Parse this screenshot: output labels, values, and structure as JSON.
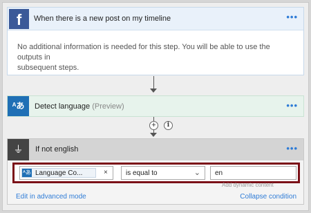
{
  "trigger": {
    "icon": "facebook-icon",
    "icon_glyph": "f",
    "title": "When there is a new post on my timeline",
    "more": "•••",
    "body_line1": "No additional information is needed for this step. You will be able to use the outputs in",
    "body_line2": "subsequent steps."
  },
  "detect": {
    "icon": "translate-icon",
    "icon_glyph": "ᴬあ",
    "title": "Detect language",
    "preview": "(Preview)",
    "more": "•••"
  },
  "connector": {
    "plus": "+",
    "info": "i"
  },
  "condition": {
    "icon": "condition-icon",
    "icon_glyph": "⏚",
    "title": "If not english",
    "more": "•••",
    "token_label": "Language Co...",
    "token_remove": "×",
    "operator": "is equal to",
    "value": "en",
    "hint": "Add dynamic content",
    "edit_advanced": "Edit in advanced mode",
    "collapse": "Collapse condition"
  },
  "colors": {
    "facebook": "#3b5998",
    "accent": "#2f7cd6",
    "highlight": "#7b1118"
  }
}
